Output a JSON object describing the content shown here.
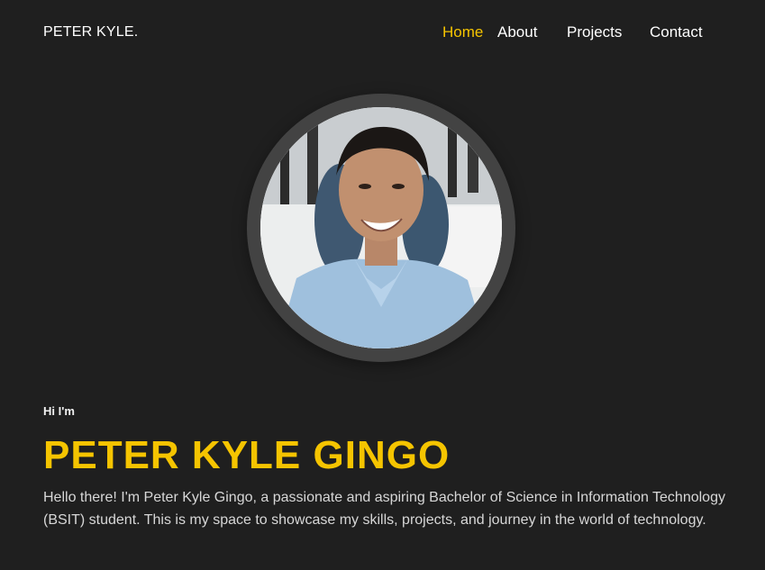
{
  "nav": {
    "brand": "PETER KYLE.",
    "links": [
      {
        "label": "Home",
        "active": true
      },
      {
        "label": "About",
        "active": false
      },
      {
        "label": "Projects",
        "active": false
      },
      {
        "label": "Contact",
        "active": false
      }
    ]
  },
  "hero": {
    "greeting": "Hi I'm",
    "name": "PETER KYLE GINGO",
    "intro": "Hello there! I'm Peter Kyle Gingo, a passionate and aspiring Bachelor of Science in Information Technology (BSIT) student. This is my space to showcase my skills, projects, and journey in the world of technology."
  },
  "colors": {
    "background": "#1f1f1f",
    "accent": "#f5c400",
    "ring": "#434343"
  }
}
